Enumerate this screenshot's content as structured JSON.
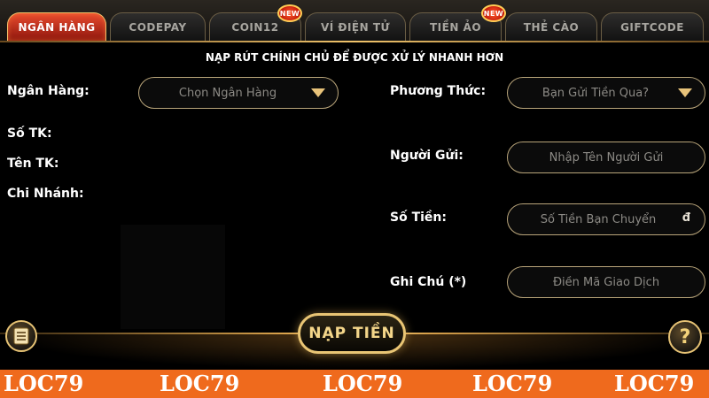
{
  "tabs": [
    {
      "label": "NGÂN HÀNG",
      "active": true,
      "badge": ""
    },
    {
      "label": "CODEPAY",
      "active": false,
      "badge": ""
    },
    {
      "label": "COIN12",
      "active": false,
      "badge": "NEW"
    },
    {
      "label": "VÍ ĐIỆN TỬ",
      "active": false,
      "badge": ""
    },
    {
      "label": "TIỀN ẢO",
      "active": false,
      "badge": "NEW"
    },
    {
      "label": "THẺ CÀO",
      "active": false,
      "badge": ""
    },
    {
      "label": "GIFTCODE",
      "active": false,
      "badge": ""
    }
  ],
  "notice": "NẠP RÚT CHÍNH CHỦ ĐỂ ĐƯỢC XỬ LÝ NHANH HƠN",
  "left": {
    "bank_label": "Ngân Hàng:",
    "bank_select": "Chọn Ngân Hàng",
    "account_no_label": "Số TK:",
    "account_name_label": "Tên TK:",
    "branch_label": "Chi Nhánh:"
  },
  "right": {
    "method_label": "Phương Thức:",
    "method_select": "Bạn Gửi Tiền Qua?",
    "sender_label": "Người Gửi:",
    "sender_placeholder": "Nhập Tên Người Gửi",
    "amount_label": "Số Tiền:",
    "amount_placeholder": "Số Tiền Bạn Chuyển",
    "currency": "đ",
    "note_label": "Ghi Chú (*)",
    "note_placeholder": "Điền Mã Giao Dịch"
  },
  "submit_label": "NẠP TIỀN",
  "help_symbol": "?",
  "watermark": "LOC79",
  "icons": {
    "menu": "document-list-icon",
    "help": "question-icon",
    "dropdown": "caret-down-icon"
  },
  "colors": {
    "active_tab": "#d6331c",
    "gold": "#e9c574",
    "watermark_bar": "#ef6a1d"
  }
}
